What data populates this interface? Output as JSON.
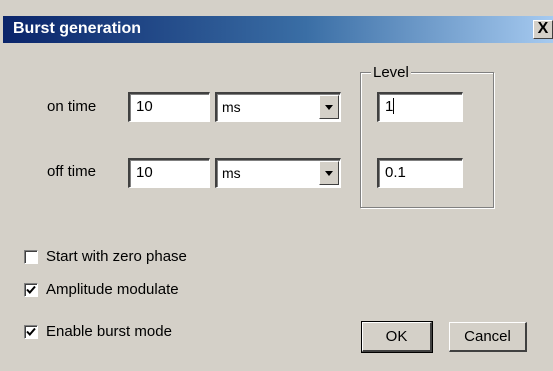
{
  "window": {
    "title": "Burst generation",
    "close_label": "X"
  },
  "on_time": {
    "label": "on time",
    "value": "10",
    "unit": "ms"
  },
  "off_time": {
    "label": "off time",
    "value": "10",
    "unit": "ms"
  },
  "level_group": {
    "legend": "Level",
    "on_level": "1",
    "off_level": "0.1"
  },
  "options": [
    {
      "label": "Start with zero phase",
      "checked": false
    },
    {
      "label": "Amplitude modulate",
      "checked": true
    },
    {
      "label": "Enable burst mode",
      "checked": true
    }
  ],
  "buttons": {
    "ok": "OK",
    "cancel": "Cancel"
  },
  "icons": {
    "dropdown": "chevron-down-icon",
    "check": "check-icon"
  }
}
